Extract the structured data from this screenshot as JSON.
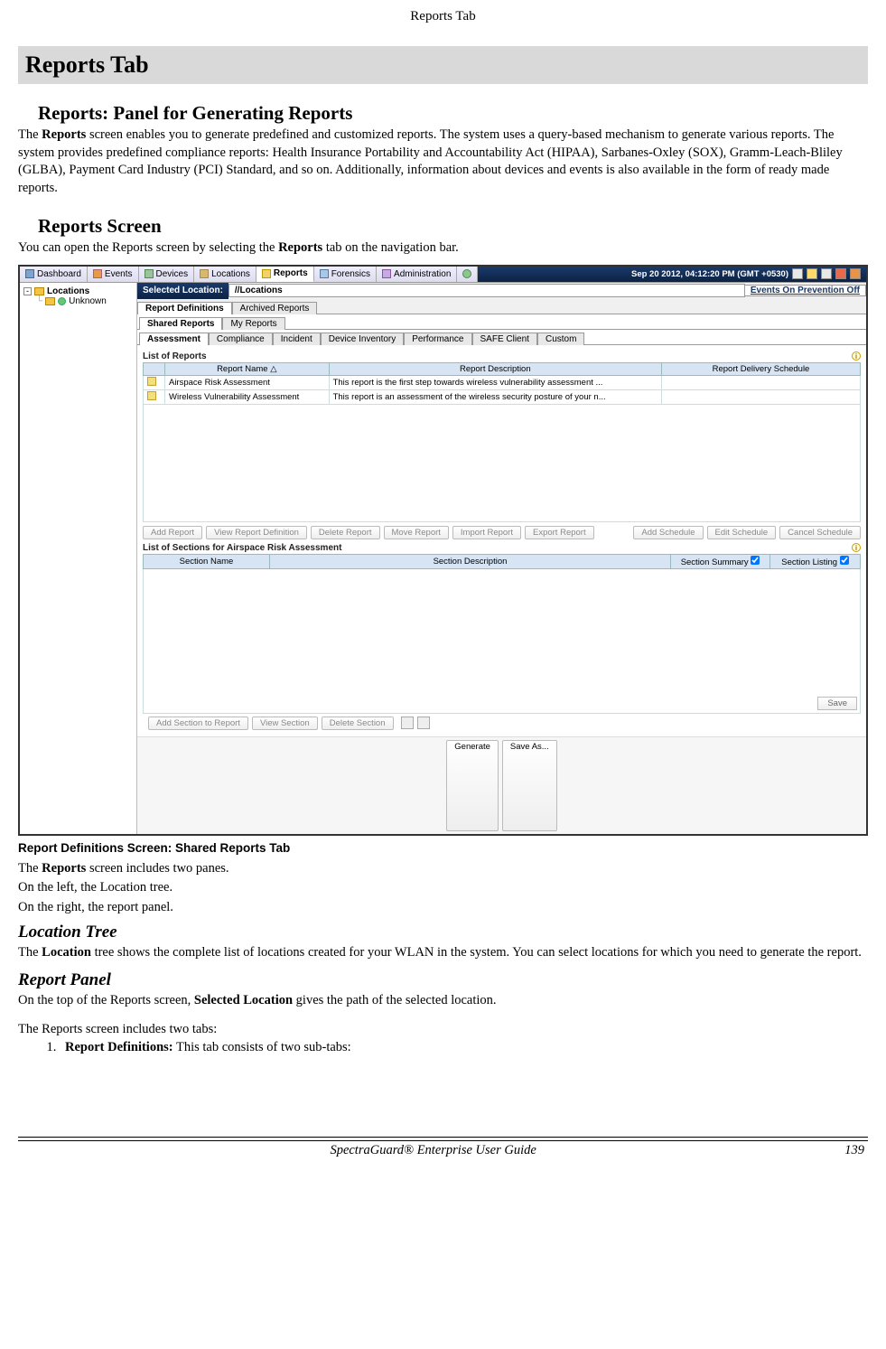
{
  "doc": {
    "header": "Reports Tab",
    "section_bar": "Reports Tab",
    "h2_a": "Reports: Panel for Generating Reports",
    "p_a_before": "The ",
    "p_a_bold": "Reports",
    "p_a_after": " screen enables you to generate predefined and customized reports. The system uses a query-based mechanism to generate various reports. The system provides predefined compliance reports: Health Insurance Portability and Accountability Act (HIPAA), Sarbanes-Oxley (SOX), Gramm-Leach-Bliley (GLBA), Payment Card Industry (PCI) Standard, and so on. Additionally, information about devices and events is also available in the form of ready made reports.",
    "h2_b": "Reports Screen",
    "p_b_before": "You can open the Reports screen by selecting the ",
    "p_b_bold": "Reports",
    "p_b_after": " tab on the navigation bar.",
    "caption": "Report Definitions Screen: Shared Reports Tab",
    "p_c1_before": "The ",
    "p_c1_bold": "Reports",
    "p_c1_after": " screen includes two panes.",
    "p_c2": "On the left, the Location tree.",
    "p_c3": "On the right, the report panel.",
    "h3_a": "Location Tree",
    "p_d_before": "The ",
    "p_d_bold": "Location",
    "p_d_after": " tree shows the complete list of locations created for your WLAN in the system. You can select locations for which you need to generate the report.",
    "h3_b": "Report Panel",
    "p_e_before": "On the top of the Reports screen, ",
    "p_e_bold": "Selected Location",
    "p_e_after": " gives the path of the selected location.",
    "p_f": "The Reports screen includes two tabs:",
    "li_1_bold": "Report Definitions:",
    "li_1_rest": " This tab consists of two sub-tabs:"
  },
  "shot": {
    "nav": {
      "tabs": [
        "Dashboard",
        "Events",
        "Devices",
        "Locations",
        "Reports",
        "Forensics",
        "Administration"
      ],
      "active_index": 4,
      "timestamp": "Sep 20 2012, 04:12:20 PM (GMT +0530)"
    },
    "tree": {
      "root": "Locations",
      "child": "Unknown"
    },
    "sel_loc": {
      "label": "Selected Location:",
      "value": "//Locations",
      "right": "Events On  Prevention Off"
    },
    "tabs_level2": {
      "items": [
        "Report Definitions",
        "Archived Reports"
      ],
      "active": 0
    },
    "tabs_level3": {
      "items": [
        "Shared Reports",
        "My Reports"
      ],
      "active": 0
    },
    "tabs_level4": {
      "items": [
        "Assessment",
        "Compliance",
        "Incident",
        "Device Inventory",
        "Performance",
        "SAFE Client",
        "Custom"
      ],
      "active": 0
    },
    "list_reports_title": "List of Reports",
    "grid_cols": [
      "Report Name △",
      "Report Description",
      "Report Delivery Schedule"
    ],
    "grid_rows": [
      {
        "name": "Airspace Risk Assessment",
        "desc": "This report is the first step towards wireless vulnerability assessment ...",
        "sched": ""
      },
      {
        "name": "Wireless Vulnerability Assessment",
        "desc": "This report is an assessment of the wireless security posture of your n...",
        "sched": ""
      }
    ],
    "btns_a_left": [
      "Add Report",
      "View Report Definition",
      "Delete Report",
      "Move Report",
      "Import Report",
      "Export Report"
    ],
    "btns_a_right": [
      "Add Schedule",
      "Edit Schedule",
      "Cancel Schedule"
    ],
    "sections_title": "List of Sections for Airspace Risk Assessment",
    "sections_cols": {
      "c1": "Section Name",
      "c2": "Section Description",
      "c3": "Section Summary",
      "c4": "Section Listing"
    },
    "save_label": "Save",
    "btns_b": [
      "Add Section to Report",
      "View Section",
      "Delete Section"
    ],
    "btns_center": [
      "Generate",
      "Save As..."
    ]
  },
  "footer": {
    "title": "SpectraGuard®  Enterprise User Guide",
    "page": "139"
  }
}
